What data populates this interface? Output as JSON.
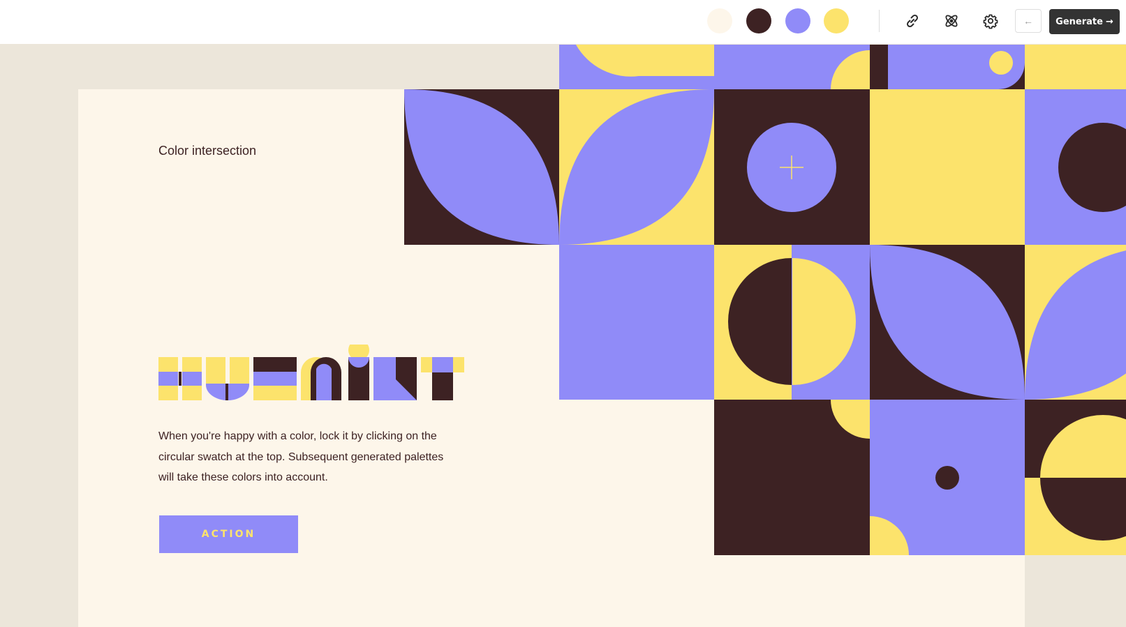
{
  "palette": {
    "colors": [
      "#fdf6ea",
      "#3d2223",
      "#908bf8",
      "#fce36c"
    ],
    "names": [
      "cream",
      "dark-brown",
      "periwinkle",
      "yellow"
    ]
  },
  "toolbar": {
    "icons": [
      "link-icon",
      "atom-icon",
      "gear-icon"
    ],
    "back_label": "←",
    "generate_label": "Generate",
    "generate_arrow": "→"
  },
  "content": {
    "eyebrow": "Color intersection",
    "logo_text": "huemint",
    "description": "When you're happy with a color, lock it by clicking on the circular swatch at the top. Subsequent generated palettes will take these colors into account.",
    "action_label": "ACTION"
  }
}
